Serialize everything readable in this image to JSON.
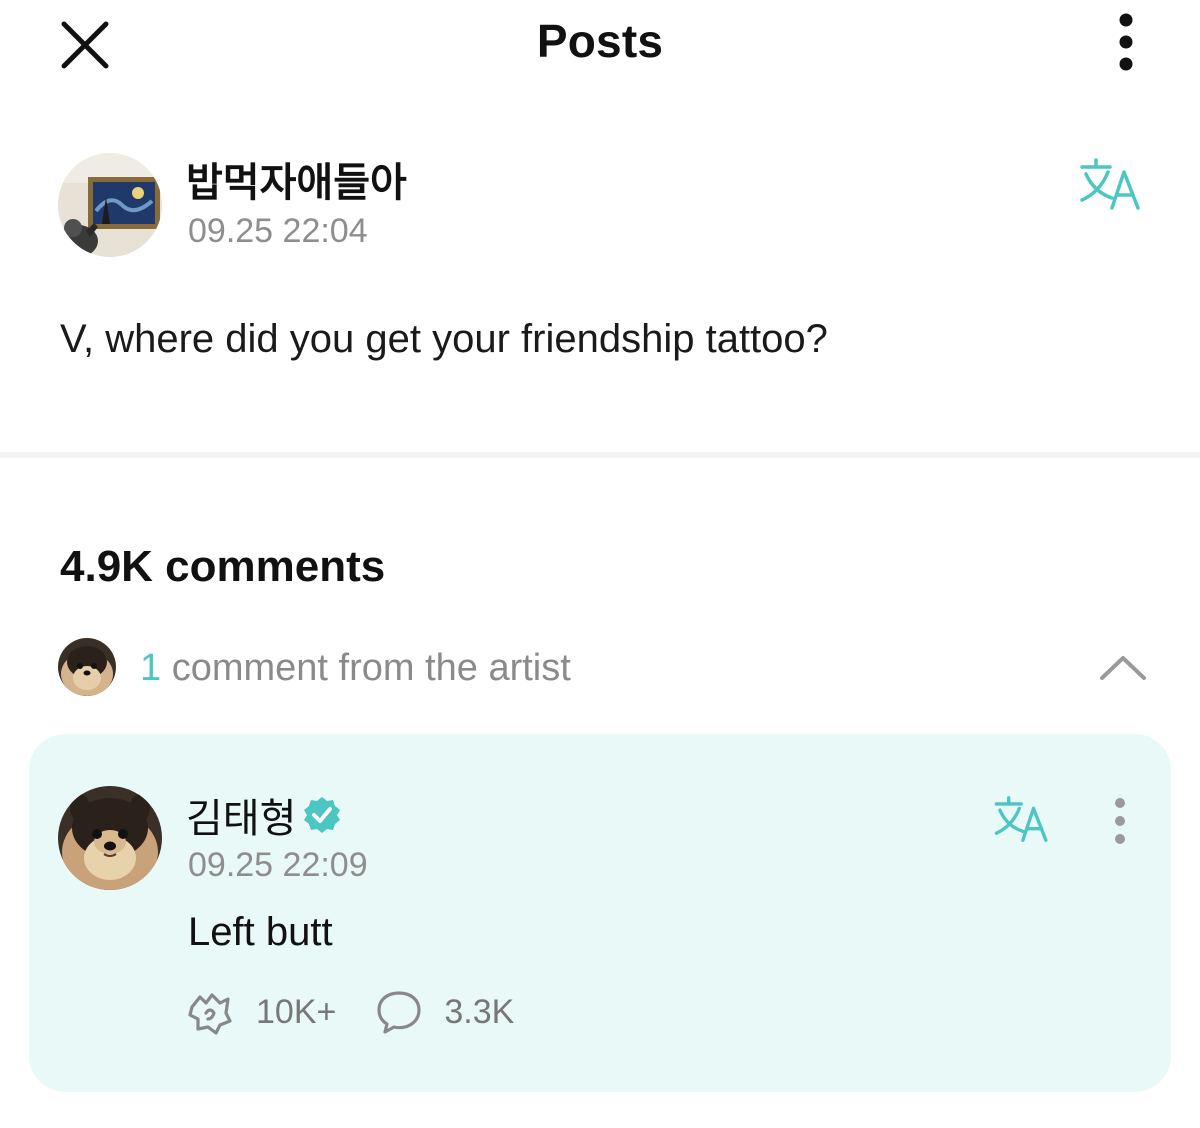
{
  "header": {
    "title": "Posts"
  },
  "post": {
    "author": "밥먹자애들아",
    "timestamp": "09.25 22:04",
    "body": "V, where did you get your friendship tattoo?"
  },
  "comments": {
    "count_label": "4.9K comments",
    "artist_summary": {
      "count": "1",
      "label": " comment from the artist"
    }
  },
  "artist_comment": {
    "author": "김태형",
    "timestamp": "09.25 22:09",
    "text": "Left butt",
    "likes": "10K+",
    "replies": "3.3K"
  },
  "colors": {
    "accent": "#4cc6c2",
    "card_background": "#e9f9f7",
    "muted_text": "#8e8e8e"
  }
}
